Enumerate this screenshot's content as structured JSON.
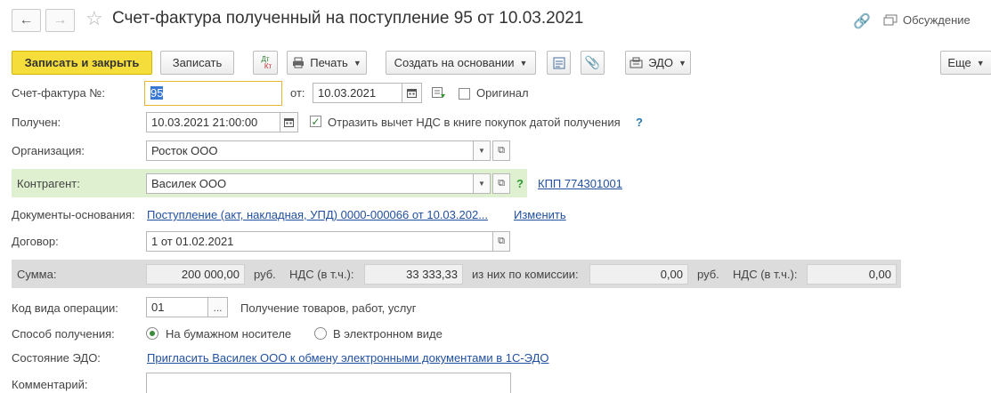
{
  "window": {
    "title": "Счет-фактура полученный на поступление 95 от 10.03.2021",
    "discussion": "Обсуждение"
  },
  "toolbar": {
    "save_close": "Записать и закрыть",
    "save": "Записать",
    "dtkt_top": "Дт",
    "dtkt_bottom": "Кт",
    "print": "Печать",
    "create_based": "Создать на основании",
    "edo": "ЭДО",
    "more": "Еще"
  },
  "form": {
    "invoice_label": "Счет-фактура №:",
    "invoice_number": "95",
    "from_label": "от:",
    "from_date": "10.03.2021",
    "original_label": "Оригинал",
    "received_label": "Получен:",
    "received_datetime": "10.03.2021 21:00:00",
    "vat_deduction_label": "Отразить вычет НДС в книге покупок датой получения",
    "help_mark": "?",
    "org_label": "Организация:",
    "org_value": "Росток ООО",
    "counterparty_label": "Контрагент:",
    "counterparty_value": "Василек ООО",
    "kpp_link": "КПП 774301001",
    "docs_label": "Документы-основания:",
    "docs_link": "Поступление (акт, накладная, УПД) 0000-000066 от 10.03.202...",
    "change_link": "Изменить",
    "contract_label": "Договор:",
    "contract_value": "1 от 01.02.2021",
    "sum_label": "Сумма:",
    "sum_value": "200 000,00",
    "currency": "руб.",
    "vat_incl_label": "НДС (в т.ч.):",
    "vat_value": "33 333,33",
    "commission_label": "из них по комиссии:",
    "commission_value": "0,00",
    "currency2": "руб.",
    "vat_incl_label2": "НДС (в т.ч.):",
    "commission_vat_value": "0,00",
    "op_code_label": "Код вида операции:",
    "op_code_value": "01",
    "op_code_btn": "...",
    "op_code_desc": "Получение товаров, работ, услуг",
    "receipt_method_label": "Способ получения:",
    "receipt_paper": "На бумажном носителе",
    "receipt_electronic": "В электронном виде",
    "edo_state_label": "Состояние ЭДО:",
    "edo_invite_link": "Пригласить Василек ООО к обмену электронными документами в 1С-ЭДО",
    "comment_label": "Комментарий:",
    "comment_value": ""
  },
  "colors": {
    "primary_button": "#f5dd3b",
    "counterparty_band": "#dff0d0",
    "sum_band": "#dcdcdc",
    "link": "#2250a0",
    "focus": "#e8b530"
  }
}
